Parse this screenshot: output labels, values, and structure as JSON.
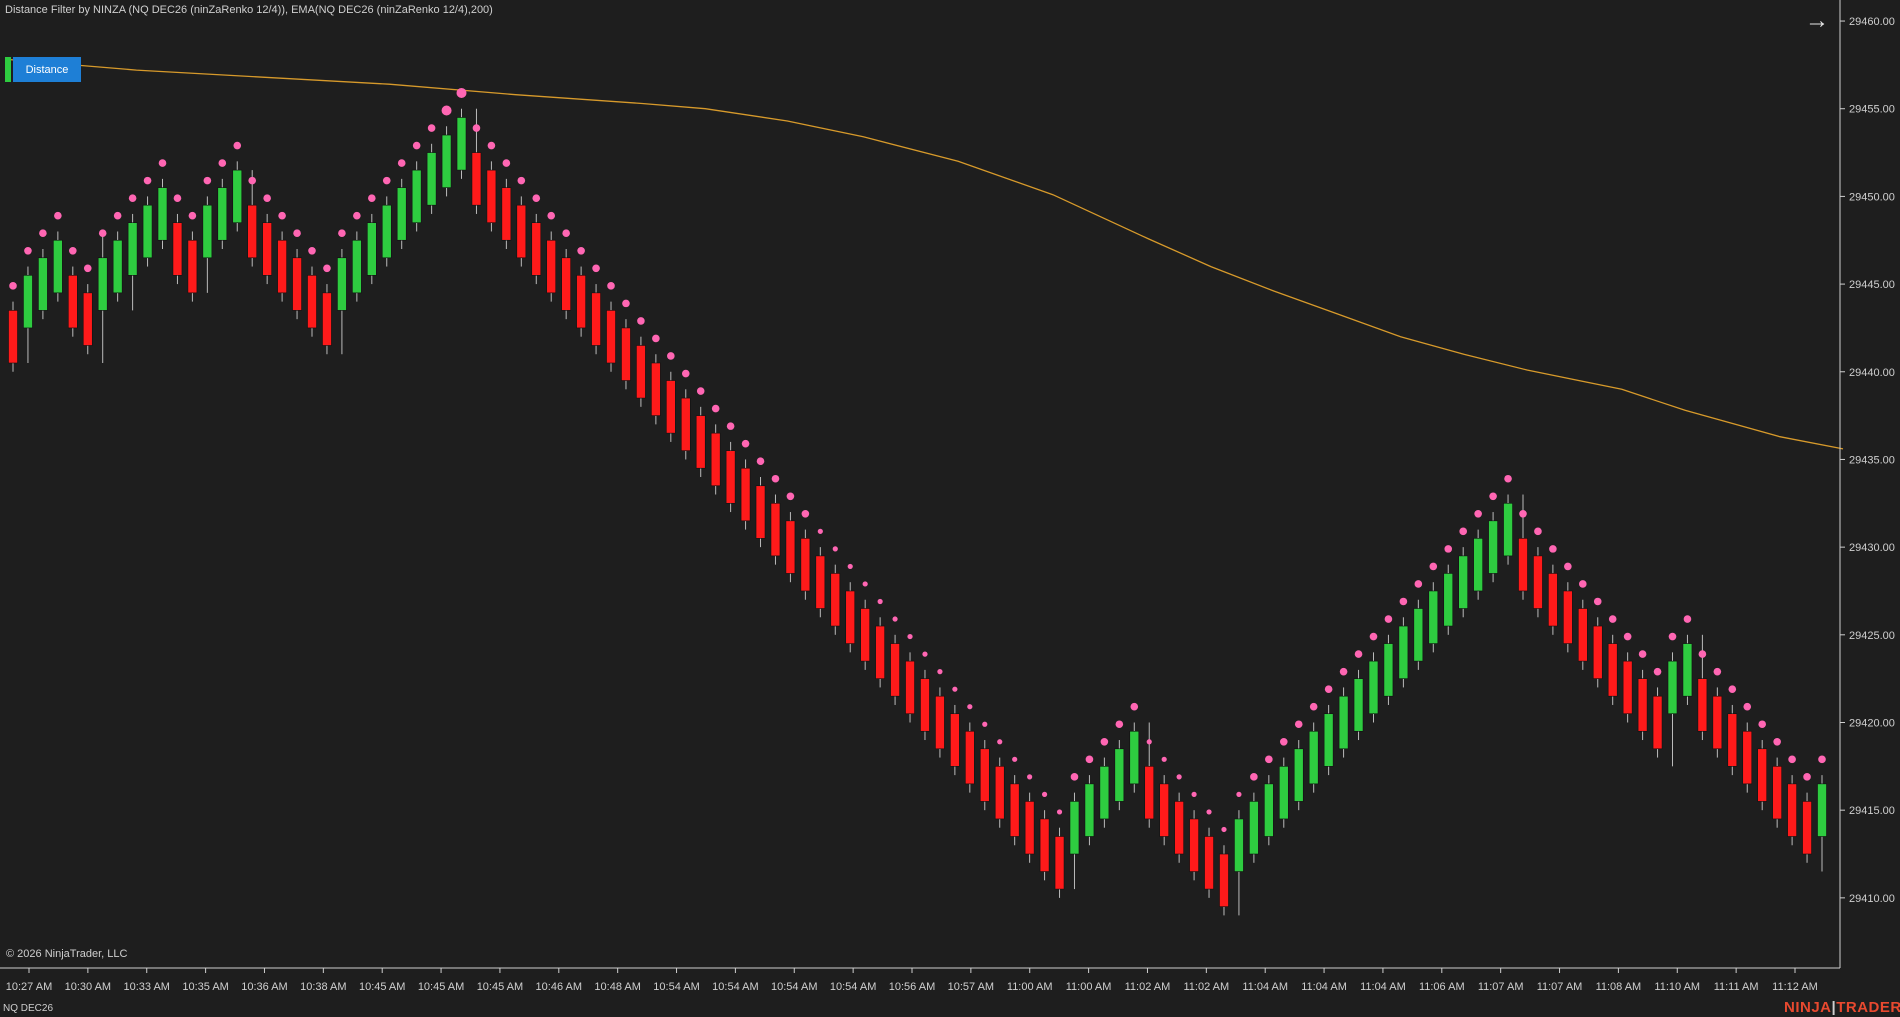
{
  "header": {
    "indicator_label": "Distance Filter by NINZA (NQ DEC26 (ninZaRenko 12/4)), EMA(NQ DEC26 (ninZaRenko 12/4),200)"
  },
  "distance_button": {
    "label": "Distance"
  },
  "footer": {
    "copyright": "© 2026 NinjaTrader, LLC",
    "instrument": "NQ DEC26",
    "brand_left": "NINJA",
    "brand_sep": "|",
    "brand_right": "TRADER"
  },
  "icons": {
    "arrow": "arrow-right-icon"
  },
  "colors": {
    "up": "#2ecc40",
    "down": "#ff1a1a",
    "dots": "#ff66b3",
    "ema": "#d79a2b",
    "background": "#1e1e1e"
  },
  "chart_data": {
    "type": "candlestick",
    "y_axis_ticks": [
      29410,
      29415,
      29420,
      29425,
      29430,
      29435,
      29440,
      29445,
      29450,
      29455,
      29460
    ],
    "y_tick_labels": [
      "29410.00",
      "29415.00",
      "29420.00",
      "29425.00",
      "29430.00",
      "29435.00",
      "29440.00",
      "29445.00",
      "29450.00",
      "29455.00",
      "29460.00"
    ],
    "ylim": [
      29406,
      29461.2
    ],
    "x_tick_labels": [
      "10:27 AM",
      "10:30 AM",
      "10:33 AM",
      "10:35 AM",
      "10:36 AM",
      "10:38 AM",
      "10:45 AM",
      "10:45 AM",
      "10:45 AM",
      "10:46 AM",
      "10:48 AM",
      "10:54 AM",
      "10:54 AM",
      "10:54 AM",
      "10:54 AM",
      "10:56 AM",
      "10:57 AM",
      "11:00 AM",
      "11:00 AM",
      "11:02 AM",
      "11:02 AM",
      "11:04 AM",
      "11:04 AM",
      "11:04 AM",
      "11:06 AM",
      "11:07 AM",
      "11:07 AM",
      "11:08 AM",
      "11:10 AM",
      "11:11 AM",
      "11:12 AM"
    ],
    "bars": [
      {
        "o": 29443.5,
        "c": 29440.5,
        "h": 29444.0,
        "l": 29440.0
      },
      {
        "o": 29442.5,
        "c": 29445.5,
        "h": 29446.0,
        "l": 29440.5
      },
      {
        "o": 29443.5,
        "c": 29446.5,
        "h": 29447.0,
        "l": 29443.0
      },
      {
        "o": 29444.5,
        "c": 29447.5,
        "h": 29448.0,
        "l": 29444.0
      },
      {
        "o": 29445.5,
        "c": 29442.5,
        "h": 29446.0,
        "l": 29442.0
      },
      {
        "o": 29444.5,
        "c": 29441.5,
        "h": 29445.0,
        "l": 29441.0
      },
      {
        "o": 29443.5,
        "c": 29446.5,
        "h": 29448.0,
        "l": 29440.5
      },
      {
        "o": 29444.5,
        "c": 29447.5,
        "h": 29448.0,
        "l": 29444.0
      },
      {
        "o": 29445.5,
        "c": 29448.5,
        "h": 29449.0,
        "l": 29443.5
      },
      {
        "o": 29446.5,
        "c": 29449.5,
        "h": 29450.0,
        "l": 29446.0
      },
      {
        "o": 29447.5,
        "c": 29450.5,
        "h": 29451.0,
        "l": 29447.0
      },
      {
        "o": 29448.5,
        "c": 29445.5,
        "h": 29449.0,
        "l": 29445.0
      },
      {
        "o": 29447.5,
        "c": 29444.5,
        "h": 29448.0,
        "l": 29444.0
      },
      {
        "o": 29446.5,
        "c": 29449.5,
        "h": 29450.0,
        "l": 29444.5
      },
      {
        "o": 29447.5,
        "c": 29450.5,
        "h": 29451.0,
        "l": 29447.0
      },
      {
        "o": 29448.5,
        "c": 29451.5,
        "h": 29452.0,
        "l": 29448.0
      },
      {
        "o": 29449.5,
        "c": 29446.5,
        "h": 29451.5,
        "l": 29446.0
      },
      {
        "o": 29448.5,
        "c": 29445.5,
        "h": 29449.0,
        "l": 29445.0
      },
      {
        "o": 29447.5,
        "c": 29444.5,
        "h": 29448.0,
        "l": 29444.0
      },
      {
        "o": 29446.5,
        "c": 29443.5,
        "h": 29447.0,
        "l": 29443.0
      },
      {
        "o": 29445.5,
        "c": 29442.5,
        "h": 29446.0,
        "l": 29442.0
      },
      {
        "o": 29444.5,
        "c": 29441.5,
        "h": 29445.0,
        "l": 29441.0
      },
      {
        "o": 29443.5,
        "c": 29446.5,
        "h": 29447.0,
        "l": 29441.0
      },
      {
        "o": 29444.5,
        "c": 29447.5,
        "h": 29448.0,
        "l": 29444.0
      },
      {
        "o": 29445.5,
        "c": 29448.5,
        "h": 29449.0,
        "l": 29445.0
      },
      {
        "o": 29446.5,
        "c": 29449.5,
        "h": 29450.0,
        "l": 29446.0
      },
      {
        "o": 29447.5,
        "c": 29450.5,
        "h": 29451.0,
        "l": 29447.0
      },
      {
        "o": 29448.5,
        "c": 29451.5,
        "h": 29452.0,
        "l": 29448.0
      },
      {
        "o": 29449.5,
        "c": 29452.5,
        "h": 29453.0,
        "l": 29449.0
      },
      {
        "o": 29450.5,
        "c": 29453.5,
        "h": 29454.0,
        "l": 29450.0
      },
      {
        "o": 29451.5,
        "c": 29454.5,
        "h": 29455.0,
        "l": 29451.0
      },
      {
        "o": 29452.5,
        "c": 29449.5,
        "h": 29455.0,
        "l": 29449.0
      },
      {
        "o": 29451.5,
        "c": 29448.5,
        "h": 29452.0,
        "l": 29448.0
      },
      {
        "o": 29450.5,
        "c": 29447.5,
        "h": 29451.0,
        "l": 29447.0
      },
      {
        "o": 29449.5,
        "c": 29446.5,
        "h": 29450.0,
        "l": 29446.0
      },
      {
        "o": 29448.5,
        "c": 29445.5,
        "h": 29449.0,
        "l": 29445.0
      },
      {
        "o": 29447.5,
        "c": 29444.5,
        "h": 29448.0,
        "l": 29444.0
      },
      {
        "o": 29446.5,
        "c": 29443.5,
        "h": 29447.0,
        "l": 29443.0
      },
      {
        "o": 29445.5,
        "c": 29442.5,
        "h": 29446.0,
        "l": 29442.0
      },
      {
        "o": 29444.5,
        "c": 29441.5,
        "h": 29445.0,
        "l": 29441.0
      },
      {
        "o": 29443.5,
        "c": 29440.5,
        "h": 29444.0,
        "l": 29440.0
      },
      {
        "o": 29442.5,
        "c": 29439.5,
        "h": 29443.0,
        "l": 29439.0
      },
      {
        "o": 29441.5,
        "c": 29438.5,
        "h": 29442.0,
        "l": 29438.0
      },
      {
        "o": 29440.5,
        "c": 29437.5,
        "h": 29441.0,
        "l": 29437.0
      },
      {
        "o": 29439.5,
        "c": 29436.5,
        "h": 29440.0,
        "l": 29436.0
      },
      {
        "o": 29438.5,
        "c": 29435.5,
        "h": 29439.0,
        "l": 29435.0
      },
      {
        "o": 29437.5,
        "c": 29434.5,
        "h": 29438.0,
        "l": 29434.0
      },
      {
        "o": 29436.5,
        "c": 29433.5,
        "h": 29437.0,
        "l": 29433.0
      },
      {
        "o": 29435.5,
        "c": 29432.5,
        "h": 29436.0,
        "l": 29432.0
      },
      {
        "o": 29434.5,
        "c": 29431.5,
        "h": 29435.0,
        "l": 29431.0
      },
      {
        "o": 29433.5,
        "c": 29430.5,
        "h": 29434.0,
        "l": 29430.0
      },
      {
        "o": 29432.5,
        "c": 29429.5,
        "h": 29433.0,
        "l": 29429.0
      },
      {
        "o": 29431.5,
        "c": 29428.5,
        "h": 29432.0,
        "l": 29428.0
      },
      {
        "o": 29430.5,
        "c": 29427.5,
        "h": 29431.0,
        "l": 29427.0
      },
      {
        "o": 29429.5,
        "c": 29426.5,
        "h": 29430.0,
        "l": 29426.0
      },
      {
        "o": 29428.5,
        "c": 29425.5,
        "h": 29429.0,
        "l": 29425.0
      },
      {
        "o": 29427.5,
        "c": 29424.5,
        "h": 29428.0,
        "l": 29424.0
      },
      {
        "o": 29426.5,
        "c": 29423.5,
        "h": 29427.0,
        "l": 29423.0
      },
      {
        "o": 29425.5,
        "c": 29422.5,
        "h": 29426.0,
        "l": 29422.0
      },
      {
        "o": 29424.5,
        "c": 29421.5,
        "h": 29425.0,
        "l": 29421.0
      },
      {
        "o": 29423.5,
        "c": 29420.5,
        "h": 29424.0,
        "l": 29420.0
      },
      {
        "o": 29422.5,
        "c": 29419.5,
        "h": 29423.0,
        "l": 29419.0
      },
      {
        "o": 29421.5,
        "c": 29418.5,
        "h": 29422.0,
        "l": 29418.0
      },
      {
        "o": 29420.5,
        "c": 29417.5,
        "h": 29421.0,
        "l": 29417.0
      },
      {
        "o": 29419.5,
        "c": 29416.5,
        "h": 29420.0,
        "l": 29416.0
      },
      {
        "o": 29418.5,
        "c": 29415.5,
        "h": 29419.0,
        "l": 29415.0
      },
      {
        "o": 29417.5,
        "c": 29414.5,
        "h": 29418.0,
        "l": 29414.0
      },
      {
        "o": 29416.5,
        "c": 29413.5,
        "h": 29417.0,
        "l": 29413.0
      },
      {
        "o": 29415.5,
        "c": 29412.5,
        "h": 29416.0,
        "l": 29412.0
      },
      {
        "o": 29414.5,
        "c": 29411.5,
        "h": 29415.0,
        "l": 29411.0
      },
      {
        "o": 29413.5,
        "c": 29410.5,
        "h": 29414.0,
        "l": 29410.0
      },
      {
        "o": 29412.5,
        "c": 29415.5,
        "h": 29416.0,
        "l": 29410.5
      },
      {
        "o": 29413.5,
        "c": 29416.5,
        "h": 29417.0,
        "l": 29413.0
      },
      {
        "o": 29414.5,
        "c": 29417.5,
        "h": 29418.0,
        "l": 29414.0
      },
      {
        "o": 29415.5,
        "c": 29418.5,
        "h": 29419.0,
        "l": 29415.0
      },
      {
        "o": 29416.5,
        "c": 29419.5,
        "h": 29420.0,
        "l": 29416.0
      },
      {
        "o": 29417.5,
        "c": 29414.5,
        "h": 29420.0,
        "l": 29414.0
      },
      {
        "o": 29416.5,
        "c": 29413.5,
        "h": 29417.0,
        "l": 29413.0
      },
      {
        "o": 29415.5,
        "c": 29412.5,
        "h": 29416.0,
        "l": 29412.0
      },
      {
        "o": 29414.5,
        "c": 29411.5,
        "h": 29415.0,
        "l": 29411.0
      },
      {
        "o": 29413.5,
        "c": 29410.5,
        "h": 29414.0,
        "l": 29410.0
      },
      {
        "o": 29412.5,
        "c": 29409.5,
        "h": 29413.0,
        "l": 29409.0
      },
      {
        "o": 29411.5,
        "c": 29414.5,
        "h": 29415.0,
        "l": 29409.0
      },
      {
        "o": 29412.5,
        "c": 29415.5,
        "h": 29416.0,
        "l": 29412.0
      },
      {
        "o": 29413.5,
        "c": 29416.5,
        "h": 29417.0,
        "l": 29413.0
      },
      {
        "o": 29414.5,
        "c": 29417.5,
        "h": 29418.0,
        "l": 29414.0
      },
      {
        "o": 29415.5,
        "c": 29418.5,
        "h": 29419.0,
        "l": 29415.0
      },
      {
        "o": 29416.5,
        "c": 29419.5,
        "h": 29420.0,
        "l": 29416.0
      },
      {
        "o": 29417.5,
        "c": 29420.5,
        "h": 29421.0,
        "l": 29417.0
      },
      {
        "o": 29418.5,
        "c": 29421.5,
        "h": 29422.0,
        "l": 29418.0
      },
      {
        "o": 29419.5,
        "c": 29422.5,
        "h": 29423.0,
        "l": 29419.0
      },
      {
        "o": 29420.5,
        "c": 29423.5,
        "h": 29424.0,
        "l": 29420.0
      },
      {
        "o": 29421.5,
        "c": 29424.5,
        "h": 29425.0,
        "l": 29421.0
      },
      {
        "o": 29422.5,
        "c": 29425.5,
        "h": 29426.0,
        "l": 29422.0
      },
      {
        "o": 29423.5,
        "c": 29426.5,
        "h": 29427.0,
        "l": 29423.0
      },
      {
        "o": 29424.5,
        "c": 29427.5,
        "h": 29428.0,
        "l": 29424.0
      },
      {
        "o": 29425.5,
        "c": 29428.5,
        "h": 29429.0,
        "l": 29425.0
      },
      {
        "o": 29426.5,
        "c": 29429.5,
        "h": 29430.0,
        "l": 29426.0
      },
      {
        "o": 29427.5,
        "c": 29430.5,
        "h": 29431.0,
        "l": 29427.0
      },
      {
        "o": 29428.5,
        "c": 29431.5,
        "h": 29432.0,
        "l": 29428.0
      },
      {
        "o": 29429.5,
        "c": 29432.5,
        "h": 29433.0,
        "l": 29429.0
      },
      {
        "o": 29430.5,
        "c": 29427.5,
        "h": 29433.0,
        "l": 29427.0
      },
      {
        "o": 29429.5,
        "c": 29426.5,
        "h": 29430.0,
        "l": 29426.0
      },
      {
        "o": 29428.5,
        "c": 29425.5,
        "h": 29429.0,
        "l": 29425.0
      },
      {
        "o": 29427.5,
        "c": 29424.5,
        "h": 29428.0,
        "l": 29424.0
      },
      {
        "o": 29426.5,
        "c": 29423.5,
        "h": 29427.0,
        "l": 29423.0
      },
      {
        "o": 29425.5,
        "c": 29422.5,
        "h": 29426.0,
        "l": 29422.0
      },
      {
        "o": 29424.5,
        "c": 29421.5,
        "h": 29425.0,
        "l": 29421.0
      },
      {
        "o": 29423.5,
        "c": 29420.5,
        "h": 29424.0,
        "l": 29420.0
      },
      {
        "o": 29422.5,
        "c": 29419.5,
        "h": 29423.0,
        "l": 29419.0
      },
      {
        "o": 29421.5,
        "c": 29418.5,
        "h": 29422.0,
        "l": 29418.0
      },
      {
        "o": 29420.5,
        "c": 29423.5,
        "h": 29424.0,
        "l": 29417.5
      },
      {
        "o": 29421.5,
        "c": 29424.5,
        "h": 29425.0,
        "l": 29421.0
      },
      {
        "o": 29422.5,
        "c": 29419.5,
        "h": 29425.0,
        "l": 29419.0
      },
      {
        "o": 29421.5,
        "c": 29418.5,
        "h": 29422.0,
        "l": 29418.0
      },
      {
        "o": 29420.5,
        "c": 29417.5,
        "h": 29421.0,
        "l": 29417.0
      },
      {
        "o": 29419.5,
        "c": 29416.5,
        "h": 29420.0,
        "l": 29416.0
      },
      {
        "o": 29418.5,
        "c": 29415.5,
        "h": 29419.0,
        "l": 29415.0
      },
      {
        "o": 29417.5,
        "c": 29414.5,
        "h": 29418.0,
        "l": 29414.0
      },
      {
        "o": 29416.5,
        "c": 29413.5,
        "h": 29417.0,
        "l": 29413.0
      },
      {
        "o": 29415.5,
        "c": 29412.5,
        "h": 29416.0,
        "l": 29412.0
      },
      {
        "o": 29413.5,
        "c": 29416.5,
        "h": 29417.0,
        "l": 29411.5
      }
    ],
    "ema": [
      [
        0,
        29457.8
      ],
      [
        20,
        29457.2
      ],
      [
        40,
        29456.8
      ],
      [
        60,
        29456.4
      ],
      [
        80,
        29455.8
      ],
      [
        100,
        29455.3
      ],
      [
        110,
        29455.0
      ],
      [
        123,
        29454.3
      ],
      [
        135,
        29453.4
      ],
      [
        150,
        29452.0
      ],
      [
        165,
        29450.1
      ],
      [
        180,
        29447.6
      ],
      [
        190,
        29446.0
      ],
      [
        200,
        29444.6
      ],
      [
        210,
        29443.3
      ],
      [
        220,
        29442.0
      ],
      [
        230,
        29441.0
      ],
      [
        240,
        29440.1
      ],
      [
        255,
        29439.0
      ],
      [
        265,
        29437.8
      ],
      [
        280,
        29436.3
      ],
      [
        290,
        29435.6
      ]
    ],
    "ema_x_max": 290
  }
}
